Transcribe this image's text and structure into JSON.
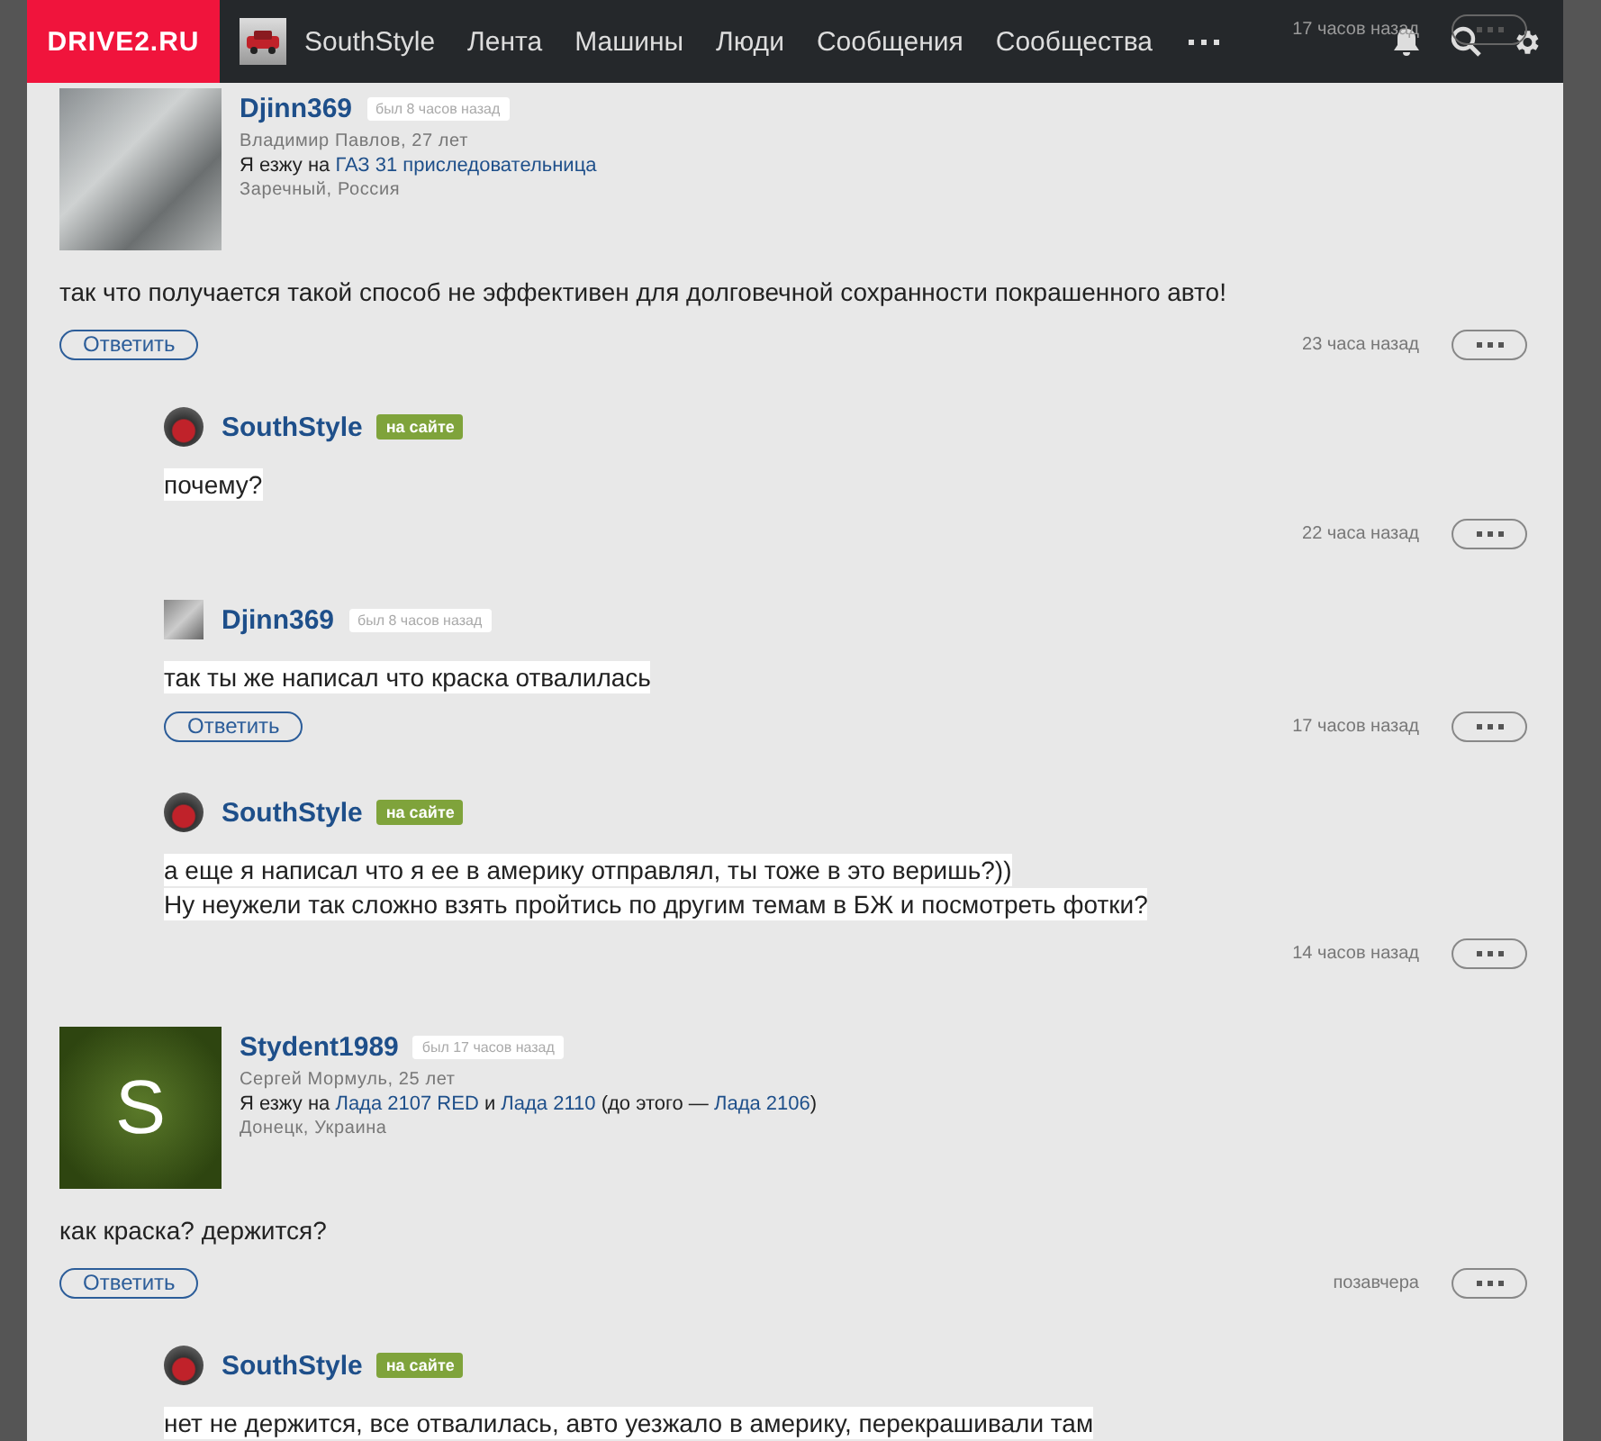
{
  "header": {
    "logo": "DRIVE2.RU",
    "user": "SouthStyle",
    "nav": [
      "Лента",
      "Машины",
      "Люди",
      "Сообщения",
      "Сообщества"
    ]
  },
  "top_footer": {
    "time": "17 часов назад"
  },
  "comments": [
    {
      "kind": "top",
      "user": "Djinn369",
      "avatar": {
        "kind": "photo"
      },
      "status": {
        "online": false,
        "text": "был 8 часов назад"
      },
      "real_name": "Владимир Павлов, 27 лет",
      "drives_parts": [
        {
          "text": "Я езжу на ",
          "link": false
        },
        {
          "text": "ГАЗ 31 приследовательница",
          "link": true
        }
      ],
      "location": "Заречный, Россия",
      "text": [
        "так что получается такой способ не эффективен для долговечной сохранности покрашенного авто!"
      ],
      "reply": "Ответить",
      "time": "23 часа назад"
    },
    {
      "kind": "reply",
      "user": "SouthStyle",
      "avatar": {
        "kind": "car"
      },
      "status": {
        "online": true,
        "text": "на сайте"
      },
      "text": [
        "почему?"
      ],
      "time": "22 часа назад"
    },
    {
      "kind": "reply",
      "user": "Djinn369",
      "avatar": {
        "kind": "photo"
      },
      "status": {
        "online": false,
        "text": "был 8 часов назад"
      },
      "text": [
        "так ты же написал что краска отвалилась"
      ],
      "reply": "Ответить",
      "time": "17 часов назад"
    },
    {
      "kind": "reply",
      "user": "SouthStyle",
      "avatar": {
        "kind": "car"
      },
      "status": {
        "online": true,
        "text": "на сайте"
      },
      "text": [
        "а еще я написал что я ее в америку отправлял, ты тоже в это веришь?))",
        "Ну неужели так сложно взять пройтись по другим темам в БЖ и посмотреть фотки?"
      ],
      "time": "14 часов назад"
    },
    {
      "kind": "top",
      "user": "Stydent1989",
      "avatar": {
        "kind": "letter",
        "letter": "S"
      },
      "status": {
        "online": false,
        "text": "был 17 часов назад"
      },
      "real_name": "Сергей Мормуль, 25 лет",
      "drives_parts": [
        {
          "text": "Я езжу на ",
          "link": false
        },
        {
          "text": "Лада 2107 RED",
          "link": true
        },
        {
          "text": " и ",
          "link": false
        },
        {
          "text": "Лада 2110",
          "link": true
        },
        {
          "text": " (до этого — ",
          "link": false
        },
        {
          "text": "Лада 2106",
          "link": true
        },
        {
          "text": ")",
          "link": false
        }
      ],
      "location": "Донецк, Украина",
      "text": [
        "как краска? держится?"
      ],
      "reply": "Ответить",
      "time": "позавчера"
    },
    {
      "kind": "reply",
      "user": "SouthStyle",
      "avatar": {
        "kind": "car"
      },
      "status": {
        "online": true,
        "text": "на сайте"
      },
      "text": [
        "нет не держится, все отвалилась, авто уезжало в америку, перекрашивали там"
      ]
    }
  ]
}
